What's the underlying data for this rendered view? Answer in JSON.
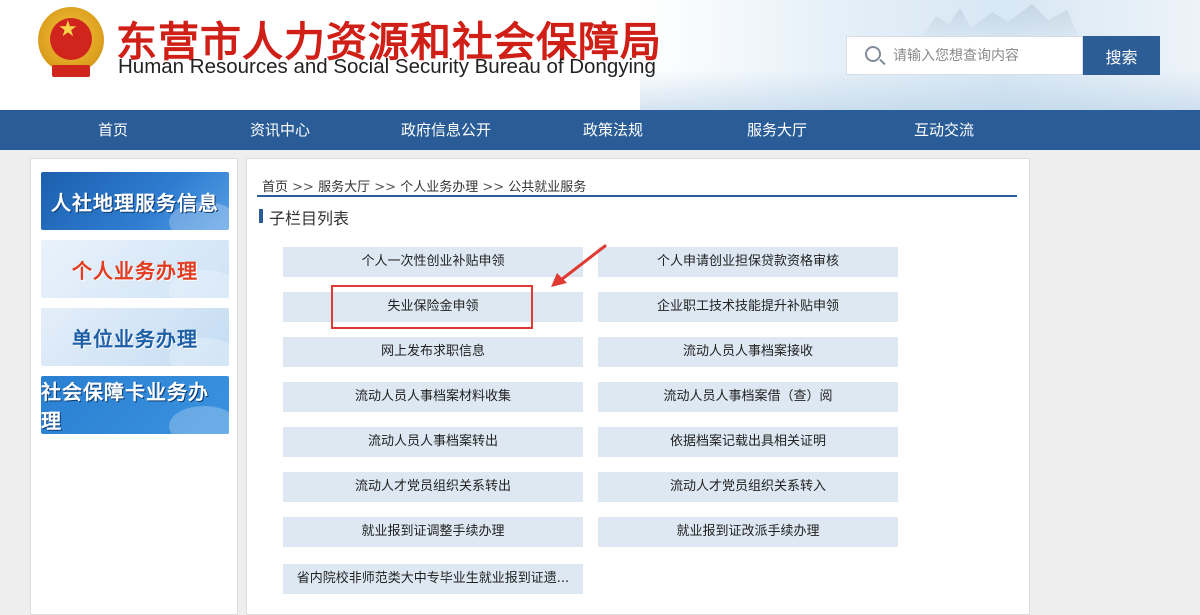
{
  "header": {
    "title_cn": "东营市人力资源和社会保障局",
    "title_en": "Human Resources and Social Security Bureau of Dongying",
    "search": {
      "placeholder": "请输入您想查询内容",
      "button_label": "搜索"
    }
  },
  "nav": {
    "items": [
      {
        "label": "首页"
      },
      {
        "label": "资讯中心"
      },
      {
        "label": "政府信息公开"
      },
      {
        "label": "政策法规"
      },
      {
        "label": "服务大厅"
      },
      {
        "label": "互动交流"
      }
    ]
  },
  "sidebar": {
    "banners": [
      {
        "label": "人社地理服务信息"
      },
      {
        "label": "个人业务办理"
      },
      {
        "label": "单位业务办理"
      },
      {
        "label": "社会保障卡业务办理"
      }
    ]
  },
  "breadcrumb": {
    "items": [
      "首页",
      "服务大厅",
      "个人业务办理",
      "公共就业服务"
    ],
    "separator": ">>"
  },
  "section": {
    "title": "子栏目列表"
  },
  "items": [
    {
      "label": "个人一次性创业补贴申领"
    },
    {
      "label": "个人申请创业担保贷款资格审核"
    },
    {
      "label": "失业保险金申领"
    },
    {
      "label": "企业职工技术技能提升补贴申领"
    },
    {
      "label": "网上发布求职信息"
    },
    {
      "label": "流动人员人事档案接收"
    },
    {
      "label": "流动人员人事档案材料收集"
    },
    {
      "label": "流动人员人事档案借（查）阅"
    },
    {
      "label": "流动人员人事档案转出"
    },
    {
      "label": "依据档案记载出具相关证明"
    },
    {
      "label": "流动人才党员组织关系转出"
    },
    {
      "label": "流动人才党员组织关系转入"
    },
    {
      "label": "就业报到证调整手续办理"
    },
    {
      "label": "就业报到证改派手续办理"
    },
    {
      "label": "省内院校非师范类大中专毕业生就业报到证遗..."
    }
  ],
  "colors": {
    "brand_red": "#cf1f16",
    "nav_blue": "#2a5d97",
    "item_bg": "#dde8f3",
    "highlight_red": "#e03a32"
  }
}
